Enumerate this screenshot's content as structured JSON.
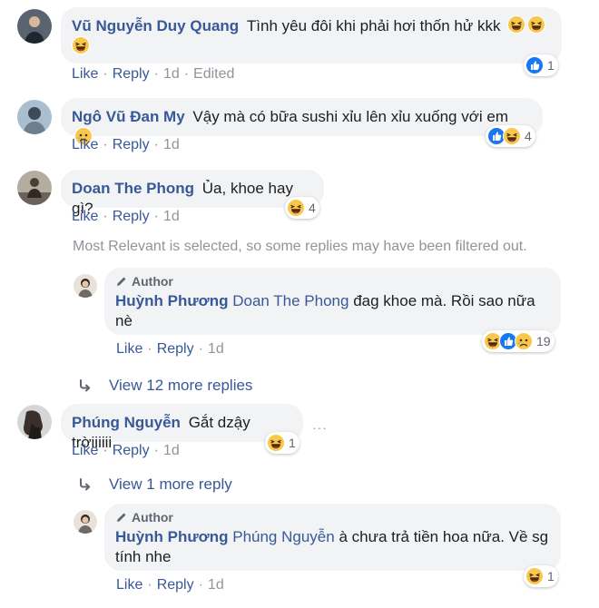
{
  "comments": [
    {
      "name": "Vũ Nguyễn Duy Quang",
      "text": "Tình yêu đôi khi phải hơi thốn hử kkk",
      "like": "Like",
      "reply": "Reply",
      "time": "1d",
      "edited": "Edited",
      "reaction_count": "1",
      "reactions": [
        "like-icon"
      ]
    },
    {
      "name": "Ngô Vũ Đan My",
      "text": "Vậy mà có bữa sushi xỉu lên xỉu xuống với em",
      "like": "Like",
      "reply": "Reply",
      "time": "1d",
      "reaction_count": "4",
      "reactions": [
        "like-icon",
        "haha-icon"
      ]
    },
    {
      "name": "Doan The Phong",
      "text": "Ủa, khoe hay gì?",
      "like": "Like",
      "reply": "Reply",
      "time": "1d",
      "reaction_count": "4",
      "reactions": [
        "haha-icon"
      ]
    },
    {
      "name": "Phúng Nguyễn",
      "text": "Gắt dzậy trờiiiiii",
      "like": "Like",
      "reply": "Reply",
      "time": "1d",
      "reaction_count": "1",
      "reactions": [
        "haha-icon"
      ],
      "more_icon": "···"
    }
  ],
  "filter_note": "Most Relevant is selected, so some replies may have been filtered out.",
  "replies": [
    {
      "badge": "Author",
      "name": "Huỳnh Phương",
      "tag": "Doan The Phong",
      "text_line1": " đag khoe mà. Rồi sao nữa",
      "text_line2": "nè",
      "like": "Like",
      "reply": "Reply",
      "time": "1d",
      "reaction_count": "19",
      "reactions": [
        "haha-icon",
        "like-icon",
        "sad-icon"
      ]
    },
    {
      "badge": "Author",
      "name": "Huỳnh Phương",
      "tag": "Phúng Nguyễn",
      "text_line1": " à chưa trả tiền hoa nữa. Về sg",
      "text_line2": "tính nhe",
      "like": "Like",
      "reply": "Reply",
      "time": "1d",
      "reaction_count": "1",
      "reactions": [
        "haha-icon"
      ]
    }
  ],
  "view_more": [
    {
      "label": "View 12 more replies"
    },
    {
      "label": "View 1 more reply"
    }
  ],
  "colors": {
    "link": "#385898",
    "bubble": "#f2f3f5",
    "meta": "#90949c",
    "like_blue": "#1877f2",
    "haha_yellow": "#f7c84b"
  }
}
